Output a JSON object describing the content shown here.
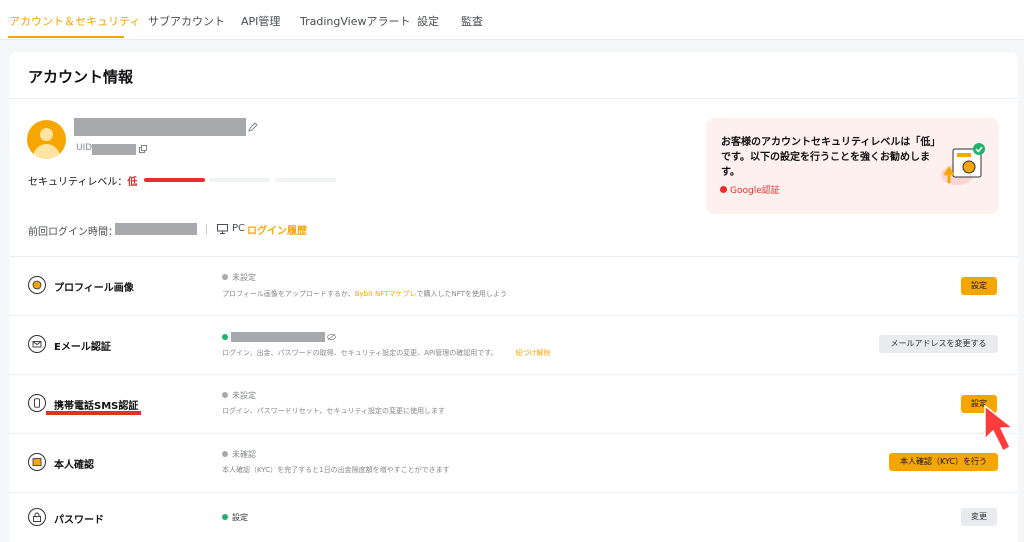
{
  "tabs": [
    {
      "label": "アカウント＆セキュリティ",
      "active": true
    },
    {
      "label": "サブアカウント"
    },
    {
      "label": "API管理"
    },
    {
      "label": "TradingViewアラート"
    },
    {
      "label": "設定"
    },
    {
      "label": "監査"
    }
  ],
  "card": {
    "title": "アカウント情報"
  },
  "profile": {
    "uid_label": "UID:",
    "security_level_label": "セキュリティレベル：",
    "security_level_value": "低",
    "security_level_progress": 0.33,
    "last_login_label": "前回ログイン時間：",
    "device": "PC",
    "login_history_link": "ログイン履歴"
  },
  "alert": {
    "text": "お客様のアカウントセキュリティレベルは「低」です。以下の設定を行うことを強くお勧めします。",
    "link": "Google認証"
  },
  "rows": [
    {
      "label": "プロフィール画像",
      "status": "未設定",
      "desc_before": "プロフィール画像をアップロードするか、",
      "desc_link": "Bybit NFTマケプレ",
      "desc_after": "で購入したNFTを使用しよう",
      "button": "設定"
    },
    {
      "label": "Eメール認証",
      "desc": "ログイン、出金、パスワードの取得、セキュリティ設定の変更、API管理の確認用です。",
      "desc_link": "紐づけ解除",
      "button": "メールアドレスを変更する"
    },
    {
      "label": "携帯電話SMS認証",
      "status": "未設定",
      "desc": "ログイン、パスワードリセット、セキュリティ設定の変更に使用します",
      "button": "設定"
    },
    {
      "label": "本人確認",
      "status": "未確認",
      "desc": "本人確認（KYC）を完了すると1日の出金限度額を増やすことができます",
      "button": "本人確認（KYC）を行う"
    },
    {
      "label": "パスワード",
      "status": "設定",
      "button": "変更"
    }
  ],
  "colors": {
    "accent": "#f7a600",
    "danger": "#e62e2e",
    "success": "#20b26c"
  }
}
